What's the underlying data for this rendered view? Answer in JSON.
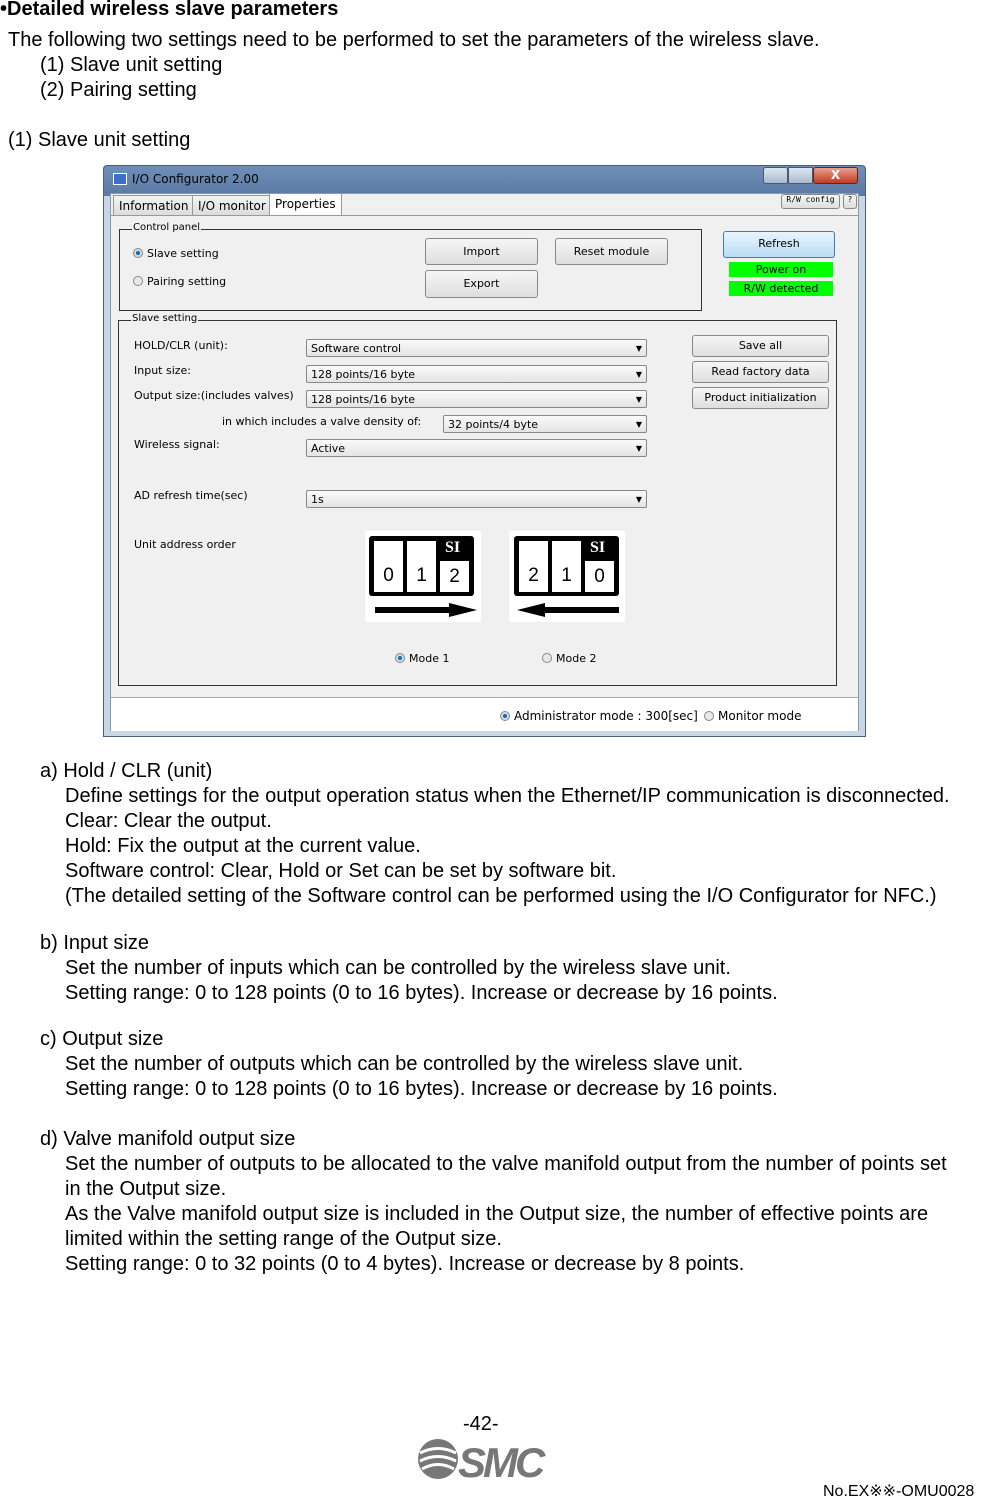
{
  "heading": "•Detailed wireless slave parameters",
  "intro": "The following two settings need to be performed to set the parameters of the wireless slave.",
  "steps": [
    "(1) Slave unit setting",
    "(2) Pairing setting"
  ],
  "section_title": "(1) Slave unit setting",
  "app": {
    "title": "I/O Configurator 2.00",
    "window_buttons": {
      "minimize": "minimize-icon",
      "maximize": "maximize-icon",
      "close": "X"
    },
    "tabs": [
      "Information",
      "I/O monitor",
      "Properties"
    ],
    "active_tab": "Properties",
    "rw_config": "R/W config",
    "help": "?",
    "control_panel": {
      "label": "Control panel",
      "radios": [
        "Slave setting",
        "Pairing setting"
      ],
      "selected": "Slave setting",
      "import": "Import",
      "export": "Export",
      "reset": "Reset module"
    },
    "refresh": "Refresh",
    "power_on": "Power on",
    "rw_detected": "R/W detected",
    "status_color": "#00ff00",
    "slave_setting": {
      "label": "Slave setting",
      "fields": [
        {
          "label": "HOLD/CLR (unit):",
          "value": "Software control"
        },
        {
          "label": "Input size:",
          "value": "128 points/16 byte"
        },
        {
          "label": "Output size:(includes valves)",
          "value": "128 points/16 byte"
        },
        {
          "label": "in which includes a valve density of:",
          "value": "32 points/4 byte"
        },
        {
          "label": "Wireless signal:",
          "value": "Active"
        },
        {
          "label": "AD refresh time(sec)",
          "value": "1s"
        }
      ],
      "save_all": "Save all",
      "read_factory": "Read factory data",
      "product_init": "Product initialization",
      "unit_address_order": "Unit address order",
      "mode1": {
        "cells": [
          "0",
          "1",
          "2"
        ],
        "si": "SI",
        "label": "Mode 1"
      },
      "mode2": {
        "cells": [
          "2",
          "1",
          "0"
        ],
        "si": "SI",
        "label": "Mode 2"
      },
      "selected_mode": "Mode 1"
    },
    "footer": {
      "admin": "Administrator mode : 300[sec]",
      "monitor": "Monitor mode",
      "selected": "Administrator mode"
    }
  },
  "sections": [
    {
      "title": "a) Hold / CLR (unit)",
      "lines": [
        "Define settings for the output operation status when the Ethernet/IP communication is disconnected.",
        "Clear: Clear the output.",
        "Hold: Fix the output at the current value.",
        "Software control: Clear, Hold or Set can be set by software bit.",
        "(The detailed setting of the Software control can be performed using the I/O Configurator for NFC.)"
      ]
    },
    {
      "title": "b) Input size",
      "lines": [
        "Set the number of inputs which can be controlled by the wireless slave unit.",
        "Setting range: 0 to 128 points (0 to 16 bytes). Increase or decrease by 16 points."
      ]
    },
    {
      "title": "c) Output size",
      "lines": [
        "Set the number of outputs which can be controlled by the wireless slave unit.",
        "Setting range: 0 to 128 points (0 to 16 bytes). Increase or decrease by 16 points."
      ]
    },
    {
      "title": "d) Valve manifold output size",
      "lines": [
        "Set the number of outputs to be allocated to the valve manifold output from the number of points set",
        "in the Output size.",
        "As the Valve manifold output size is included in the Output size, the number of effective points are",
        "limited within the setting range of the Output size.",
        "Setting range: 0 to 32 points (0 to 4 bytes). Increase or decrease by 8 points."
      ]
    }
  ],
  "page_number": "-42-",
  "logo": "SMC",
  "doc_number": "No.EX※※-OMU0028"
}
